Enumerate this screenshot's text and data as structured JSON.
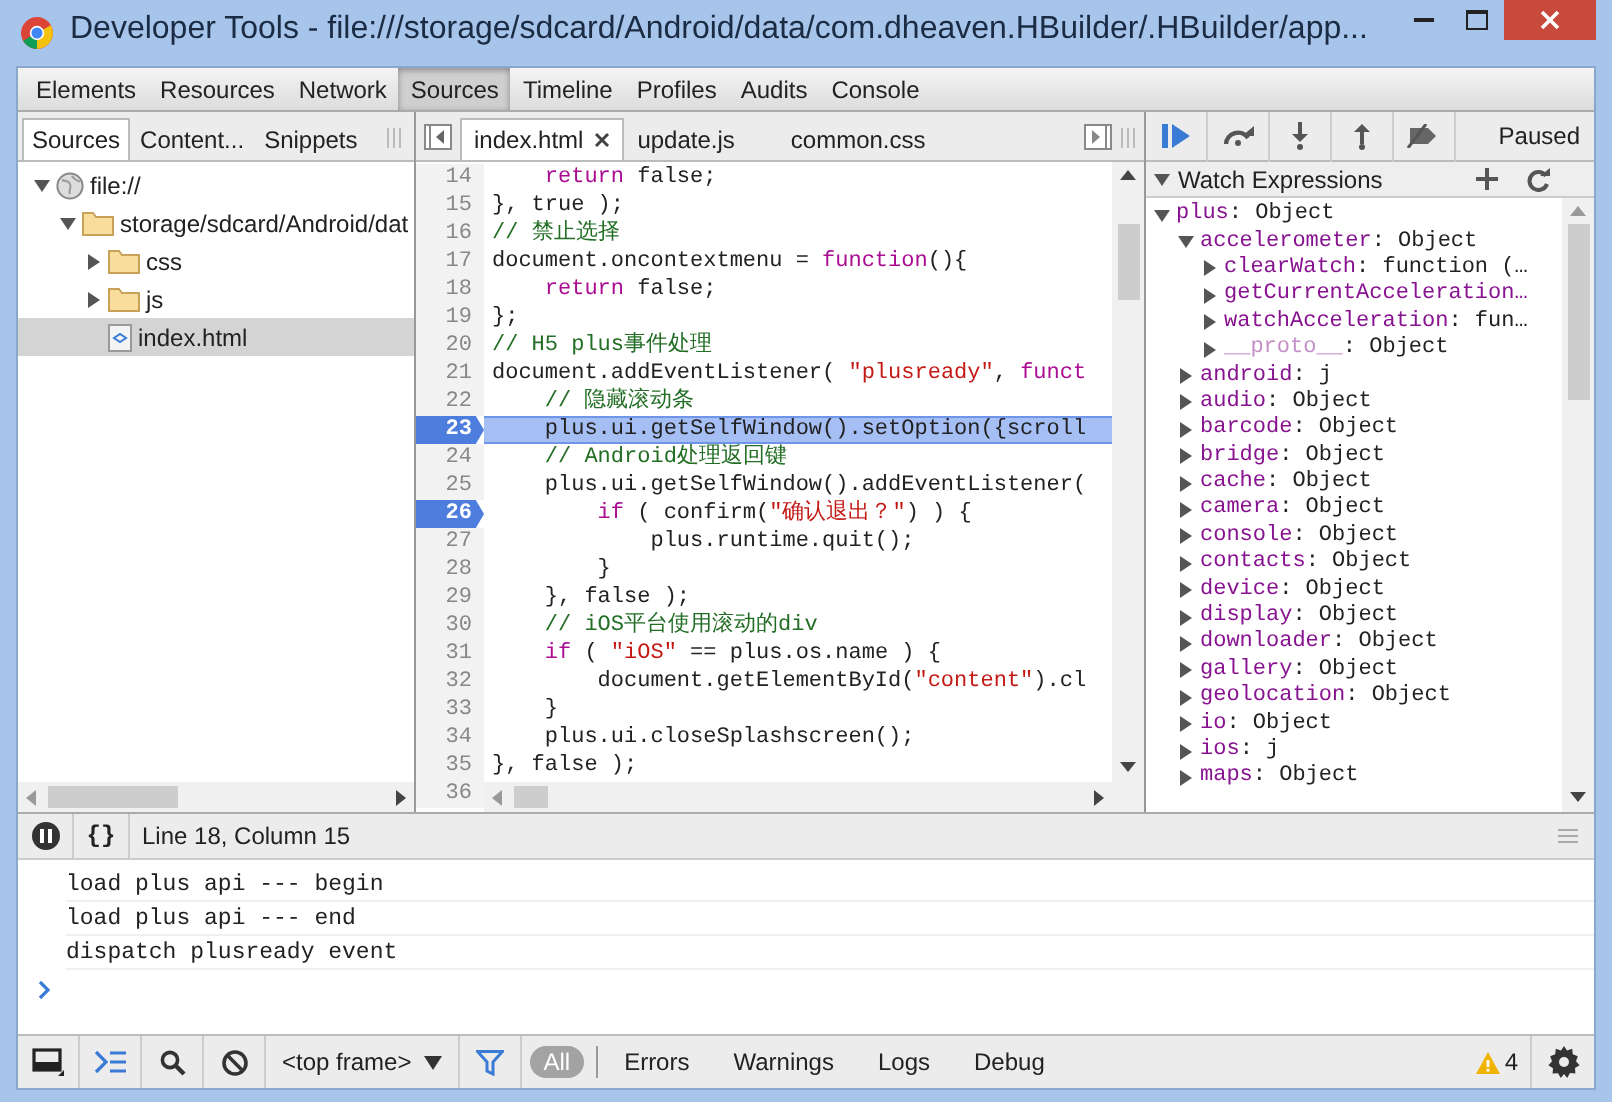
{
  "window": {
    "title": "Developer Tools - file:///storage/sdcard/Android/data/com.dheaven.HBuilder/.HBuilder/app..."
  },
  "main_tabs": [
    {
      "label": "Elements",
      "selected": false
    },
    {
      "label": "Resources",
      "selected": false
    },
    {
      "label": "Network",
      "selected": false
    },
    {
      "label": "Sources",
      "selected": true
    },
    {
      "label": "Timeline",
      "selected": false
    },
    {
      "label": "Profiles",
      "selected": false
    },
    {
      "label": "Audits",
      "selected": false
    },
    {
      "label": "Console",
      "selected": false
    }
  ],
  "navigator": {
    "tabs": [
      {
        "label": "Sources",
        "selected": true
      },
      {
        "label": "Content...",
        "selected": false
      },
      {
        "label": "Snippets",
        "selected": false
      }
    ],
    "tree": [
      {
        "label": "file://",
        "kind": "domain",
        "expanded": true,
        "selected": false,
        "children": [
          {
            "label": "storage/sdcard/Android/dat",
            "kind": "folder",
            "expanded": true,
            "selected": false,
            "children": [
              {
                "label": "css",
                "kind": "folder",
                "expanded": false,
                "selected": false
              },
              {
                "label": "js",
                "kind": "folder",
                "expanded": false,
                "selected": false
              },
              {
                "label": "index.html",
                "kind": "file",
                "selected": true
              }
            ]
          }
        ]
      }
    ]
  },
  "editor": {
    "tabs": [
      {
        "label": "index.html",
        "selected": true
      },
      {
        "label": "update.js",
        "selected": false
      },
      {
        "label": "common.css",
        "selected": false
      }
    ],
    "lines": [
      {
        "n": "14",
        "breakpoint": false,
        "current": false,
        "tokens": [
          {
            "kind": "keyword",
            "text": "    return"
          },
          {
            "kind": "plain",
            "text": " false;"
          }
        ]
      },
      {
        "n": "15",
        "breakpoint": false,
        "current": false,
        "tokens": [
          {
            "kind": "plain",
            "text": "}, true );"
          }
        ]
      },
      {
        "n": "16",
        "breakpoint": false,
        "current": false,
        "tokens": [
          {
            "kind": "comment",
            "text": "// 禁止选择"
          }
        ]
      },
      {
        "n": "17",
        "breakpoint": false,
        "current": false,
        "tokens": [
          {
            "kind": "plain",
            "text": "document.oncontextmenu = "
          },
          {
            "kind": "keyword",
            "text": "function"
          },
          {
            "kind": "plain",
            "text": "(){"
          }
        ]
      },
      {
        "n": "18",
        "breakpoint": false,
        "current": false,
        "tokens": [
          {
            "kind": "keyword",
            "text": "    return"
          },
          {
            "kind": "plain",
            "text": " false;"
          }
        ]
      },
      {
        "n": "19",
        "breakpoint": false,
        "current": false,
        "tokens": [
          {
            "kind": "plain",
            "text": "};"
          }
        ]
      },
      {
        "n": "20",
        "breakpoint": false,
        "current": false,
        "tokens": [
          {
            "kind": "comment",
            "text": "// H5 plus事件处理"
          }
        ]
      },
      {
        "n": "21",
        "breakpoint": false,
        "current": false,
        "tokens": [
          {
            "kind": "plain",
            "text": "document.addEventListener( "
          },
          {
            "kind": "string",
            "text": "\"plusready\""
          },
          {
            "kind": "plain",
            "text": ", "
          },
          {
            "kind": "keyword",
            "text": "funct"
          }
        ]
      },
      {
        "n": "22",
        "breakpoint": false,
        "current": false,
        "tokens": [
          {
            "kind": "comment",
            "text": "    // 隐藏滚动条"
          }
        ]
      },
      {
        "n": "23",
        "breakpoint": true,
        "current": true,
        "tokens": [
          {
            "kind": "plain",
            "text": "    plus.ui.getSelfWindow().setOption({scroll"
          }
        ]
      },
      {
        "n": "24",
        "breakpoint": false,
        "current": false,
        "tokens": [
          {
            "kind": "comment",
            "text": "    // Android处理返回键"
          }
        ]
      },
      {
        "n": "25",
        "breakpoint": false,
        "current": false,
        "tokens": [
          {
            "kind": "plain",
            "text": "    plus.ui.getSelfWindow().addEventListener("
          }
        ]
      },
      {
        "n": "26",
        "breakpoint": true,
        "current": false,
        "tokens": [
          {
            "kind": "keyword",
            "text": "        if"
          },
          {
            "kind": "plain",
            "text": " ( confirm("
          },
          {
            "kind": "string",
            "text": "\"确认退出？\""
          },
          {
            "kind": "plain",
            "text": ") ) {"
          }
        ]
      },
      {
        "n": "27",
        "breakpoint": false,
        "current": false,
        "tokens": [
          {
            "kind": "plain",
            "text": "            plus.runtime.quit();"
          }
        ]
      },
      {
        "n": "28",
        "breakpoint": false,
        "current": false,
        "tokens": [
          {
            "kind": "plain",
            "text": "        }"
          }
        ]
      },
      {
        "n": "29",
        "breakpoint": false,
        "current": false,
        "tokens": [
          {
            "kind": "plain",
            "text": "    }, false );"
          }
        ]
      },
      {
        "n": "30",
        "breakpoint": false,
        "current": false,
        "tokens": [
          {
            "kind": "comment",
            "text": "    // iOS平台使用滚动的div"
          }
        ]
      },
      {
        "n": "31",
        "breakpoint": false,
        "current": false,
        "tokens": [
          {
            "kind": "keyword",
            "text": "    if"
          },
          {
            "kind": "plain",
            "text": " ( "
          },
          {
            "kind": "string",
            "text": "\"iOS\""
          },
          {
            "kind": "plain",
            "text": " == plus.os.name ) {"
          }
        ]
      },
      {
        "n": "32",
        "breakpoint": false,
        "current": false,
        "tokens": [
          {
            "kind": "plain",
            "text": "        document.getElementById("
          },
          {
            "kind": "string",
            "text": "\"content\""
          },
          {
            "kind": "plain",
            "text": ").cl"
          }
        ]
      },
      {
        "n": "33",
        "breakpoint": false,
        "current": false,
        "tokens": [
          {
            "kind": "plain",
            "text": "    }"
          }
        ]
      },
      {
        "n": "34",
        "breakpoint": false,
        "current": false,
        "tokens": [
          {
            "kind": "plain",
            "text": "    plus.ui.closeSplashscreen();"
          }
        ]
      },
      {
        "n": "35",
        "breakpoint": false,
        "current": false,
        "tokens": [
          {
            "kind": "plain",
            "text": "}, false );"
          }
        ]
      },
      {
        "n": "36",
        "breakpoint": false,
        "current": false
      }
    ]
  },
  "debugger": {
    "state": "Paused"
  },
  "watch": {
    "title": "Watch Expressions",
    "expanded": true,
    "items": [
      {
        "name": "plus",
        "value": ": Object",
        "expanded": true,
        "children": [
          {
            "name": "accelerometer",
            "value": ": Object",
            "expanded": true,
            "children": [
              {
                "name": "clearWatch",
                "value": ": function (…",
                "expanded": false,
                "kind": "property"
              },
              {
                "name": "getCurrentAcceleration…",
                "expanded": false,
                "kind": "property"
              },
              {
                "name": "watchAcceleration",
                "value": ": fun…",
                "expanded": false,
                "kind": "property"
              },
              {
                "name": "__proto__",
                "value": ": Object",
                "expanded": false,
                "kind": "internal"
              }
            ]
          },
          {
            "name": "android",
            "value": ": j",
            "expanded": false
          },
          {
            "name": "audio",
            "value": ": Object",
            "expanded": false
          },
          {
            "name": "barcode",
            "value": ": Object",
            "expanded": false
          },
          {
            "name": "bridge",
            "value": ": Object",
            "expanded": false
          },
          {
            "name": "cache",
            "value": ": Object",
            "expanded": false
          },
          {
            "name": "camera",
            "value": ": Object",
            "expanded": false
          },
          {
            "name": "console",
            "value": ": Object",
            "expanded": false
          },
          {
            "name": "contacts",
            "value": ": Object",
            "expanded": false
          },
          {
            "name": "device",
            "value": ": Object",
            "expanded": false
          },
          {
            "name": "display",
            "value": ": Object",
            "expanded": false
          },
          {
            "name": "downloader",
            "value": ": Object",
            "expanded": false
          },
          {
            "name": "gallery",
            "value": ": Object",
            "expanded": false
          },
          {
            "name": "geolocation",
            "value": ": Object",
            "expanded": false
          },
          {
            "name": "io",
            "value": ": Object",
            "expanded": false
          },
          {
            "name": "ios",
            "value": ": j",
            "expanded": false
          },
          {
            "name": "maps",
            "value": ": Object",
            "expanded": false
          }
        ]
      }
    ]
  },
  "status": {
    "pretty_print": "{}",
    "position": "Line 18, Column 15"
  },
  "console": {
    "messages": [
      "load plus api --- begin",
      "load plus api --- end",
      "dispatch plusready event"
    ]
  },
  "bottom_bar": {
    "frame": "<top frame>",
    "filters": [
      {
        "label": "All",
        "selected": true
      },
      {
        "label": "Errors",
        "selected": false
      },
      {
        "label": "Warnings",
        "selected": false
      },
      {
        "label": "Logs",
        "selected": false
      },
      {
        "label": "Debug",
        "selected": false
      }
    ],
    "warnings": "4"
  }
}
